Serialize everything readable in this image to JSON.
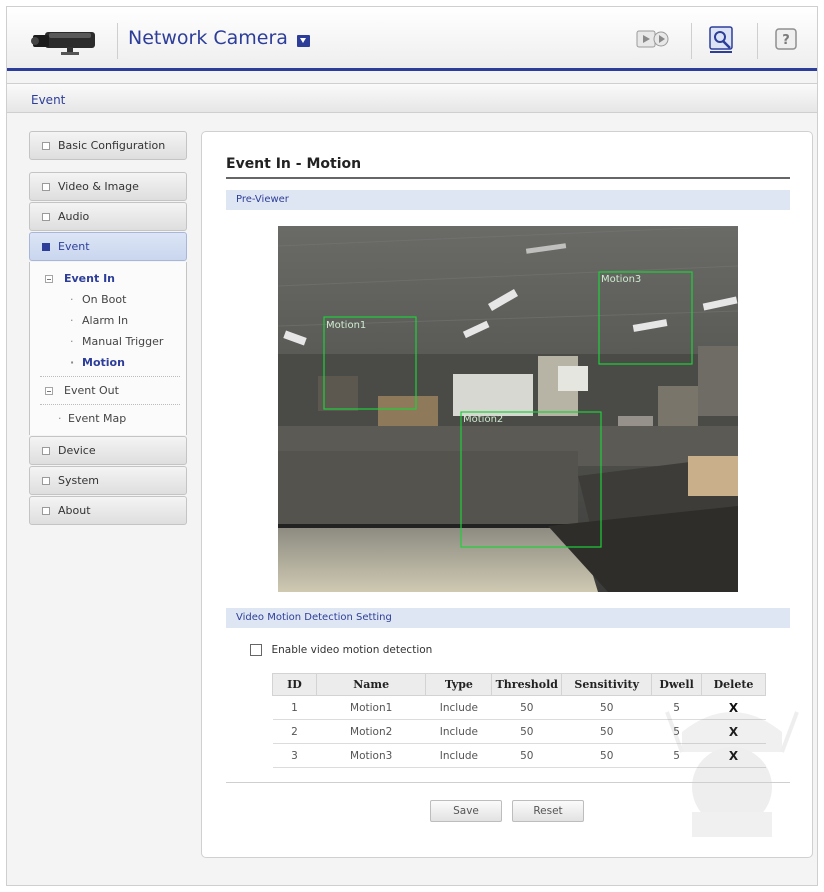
{
  "header": {
    "app_title": "Network Camera",
    "icons": [
      "camera-logo-icon",
      "live-view-icon",
      "setup-icon",
      "help-icon"
    ],
    "accent": "#2d3e9a"
  },
  "breadcrumb": "Event",
  "sidebar": {
    "items": [
      {
        "label": "Basic Configuration"
      },
      {
        "label": "Video & Image"
      },
      {
        "label": "Audio"
      },
      {
        "label": "Event"
      },
      {
        "label": "Device"
      },
      {
        "label": "System"
      },
      {
        "label": "About"
      }
    ],
    "event_sub": {
      "event_in": "Event In",
      "event_in_items": [
        "On Boot",
        "Alarm In",
        "Manual Trigger",
        "Motion"
      ],
      "event_out": "Event Out",
      "event_map": "Event Map"
    }
  },
  "main": {
    "title": "Event In - Motion",
    "previewer_label": "Pre-Viewer",
    "vmd_section_label": "Video Motion Detection Setting",
    "enable_label": "Enable video motion detection",
    "enable_checked": false,
    "regions": [
      "Motion1",
      "Motion2",
      "Motion3"
    ],
    "table": {
      "headers": [
        "ID",
        "Name",
        "Type",
        "Threshold",
        "Sensitivity",
        "Dwell",
        "Delete"
      ],
      "rows": [
        [
          "1",
          "Motion1",
          "Include",
          "50",
          "50",
          "5",
          "X"
        ],
        [
          "2",
          "Motion2",
          "Include",
          "50",
          "50",
          "5",
          "X"
        ],
        [
          "3",
          "Motion3",
          "Include",
          "50",
          "50",
          "5",
          "X"
        ]
      ]
    },
    "save_label": "Save",
    "reset_label": "Reset"
  }
}
